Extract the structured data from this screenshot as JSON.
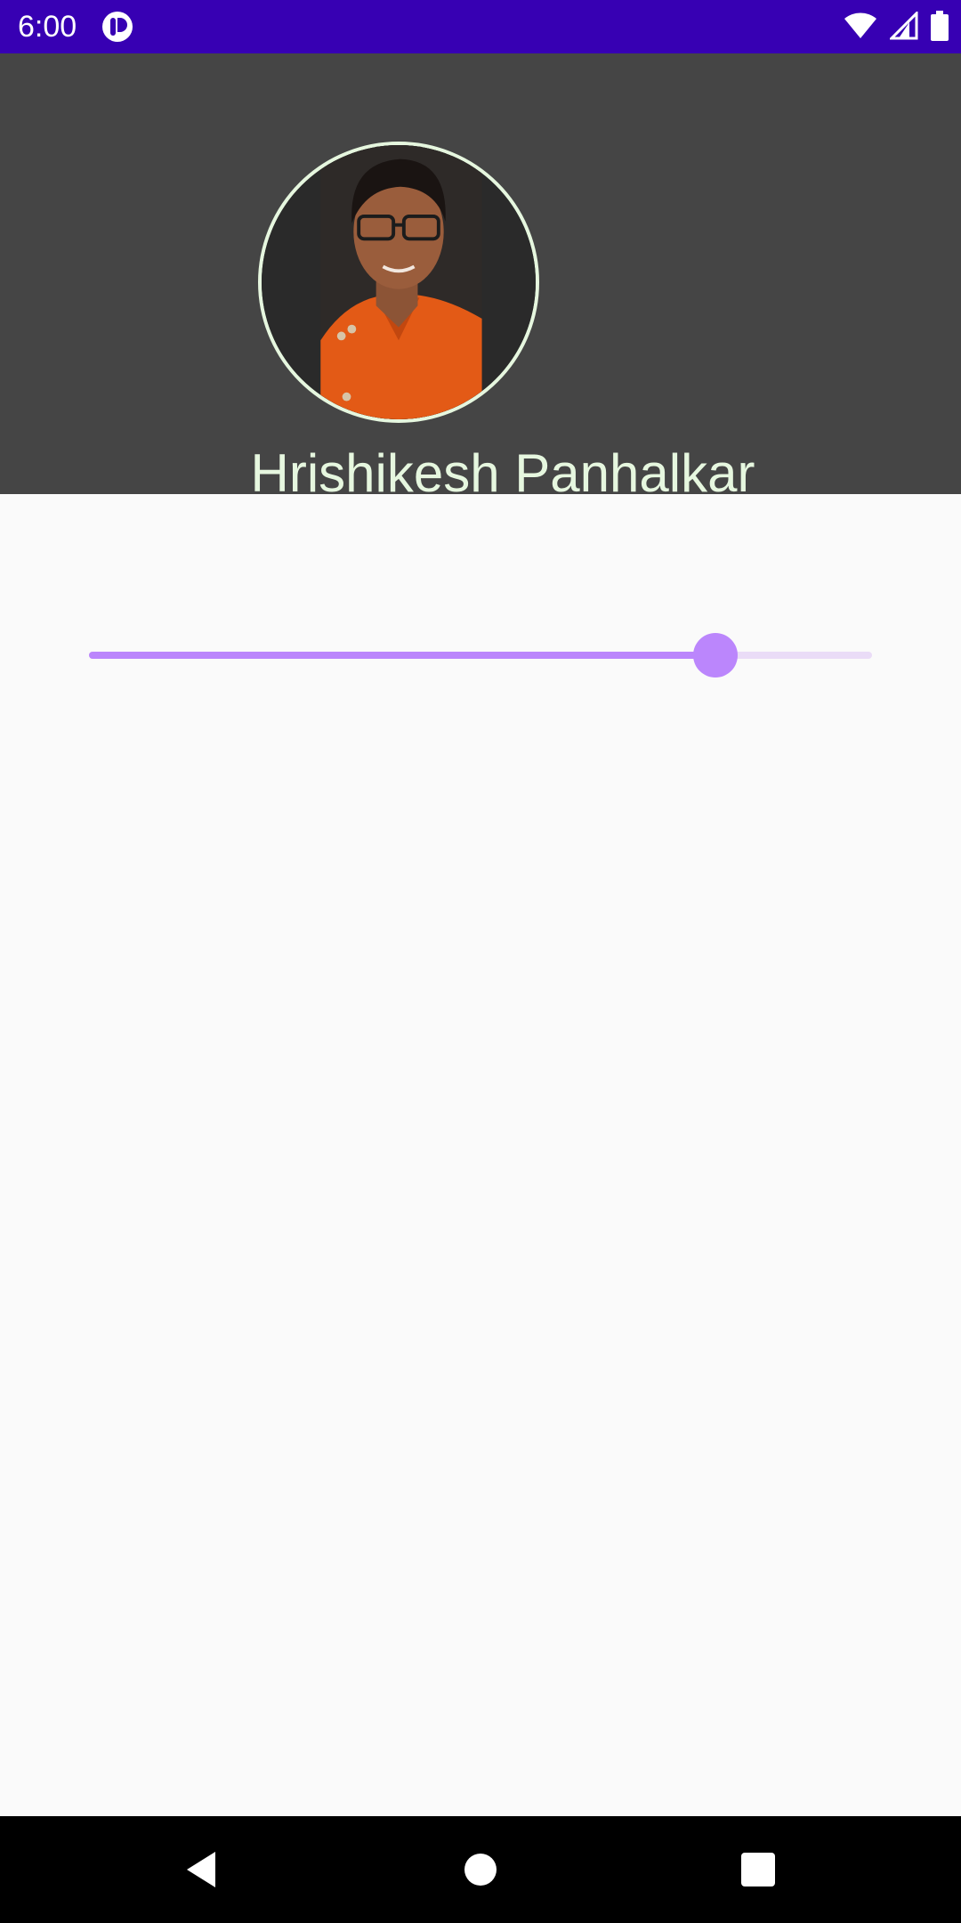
{
  "status_bar": {
    "time": "6:00",
    "icons": [
      "notification-app-icon",
      "wifi-icon",
      "signal-icon",
      "battery-icon"
    ],
    "background": "#3700b3"
  },
  "profile": {
    "name": "Hrishikesh Panhalkar",
    "name_color": "#e6f7df",
    "header_background": "#454545"
  },
  "slider": {
    "value_fraction": 0.8,
    "accent": "#bb86fc"
  },
  "nav_bar": {
    "buttons": [
      "back-icon",
      "home-icon",
      "recents-icon"
    ]
  }
}
